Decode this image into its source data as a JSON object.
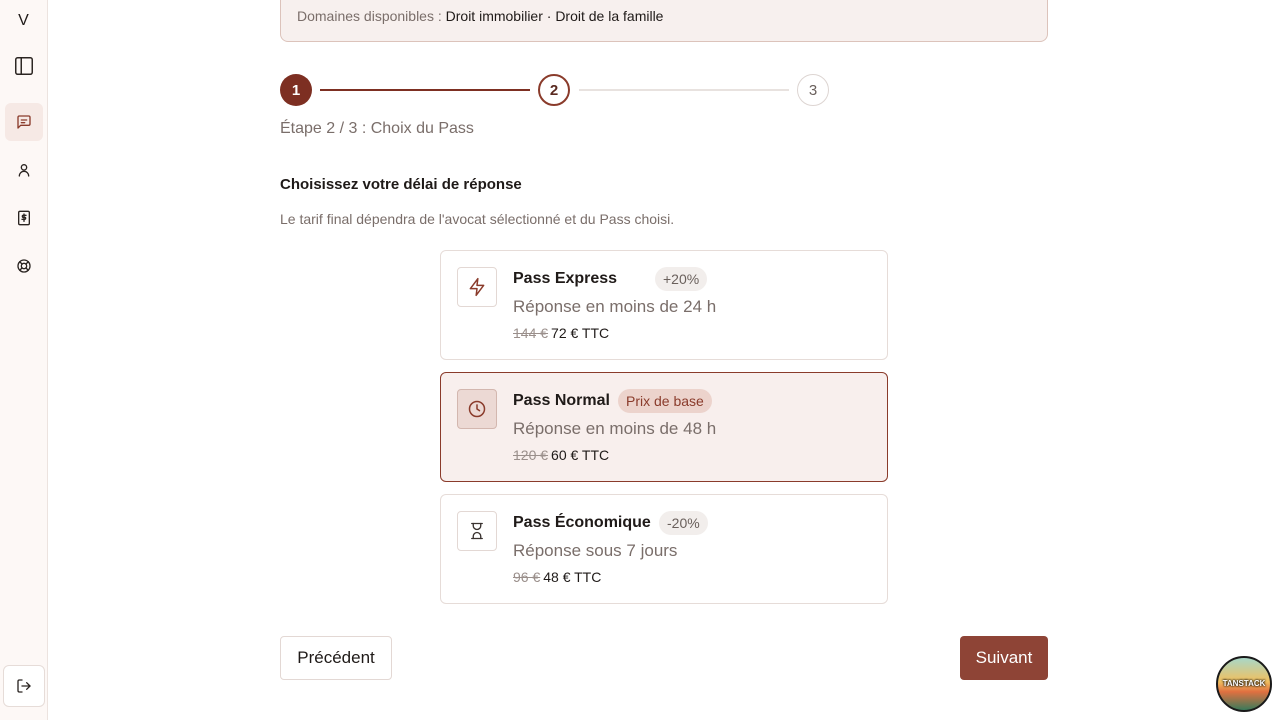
{
  "sidebar": {
    "logo": "V",
    "items": [
      {
        "name": "toggle-sidebar",
        "icon": "panel-left-icon"
      },
      {
        "name": "messages",
        "icon": "message-square-icon",
        "active": true
      },
      {
        "name": "profile",
        "icon": "user-icon"
      },
      {
        "name": "billing",
        "icon": "receipt-dollar-icon"
      },
      {
        "name": "support",
        "icon": "life-buoy-icon"
      }
    ],
    "logout_icon": "log-out-icon"
  },
  "domains": {
    "label": "Domaines disponibles : ",
    "value": "Droit immobilier · Droit de la famille"
  },
  "stepper": {
    "steps": [
      "1",
      "2",
      "3"
    ],
    "current": 2,
    "label": "Étape 2 / 3 : Choix du Pass"
  },
  "section": {
    "title": "Choisissez votre délai de réponse",
    "subtitle": "Le tarif final dépendra de l'avocat sélectionné et du Pass choisi."
  },
  "passes": [
    {
      "name": "Pass Express",
      "badge": "+20%",
      "description": "Réponse en moins de 24 h",
      "old_price": "144 €",
      "price": "72 € TTC",
      "icon": "zap-icon",
      "selected": false
    },
    {
      "name": "Pass Normal",
      "badge": "Prix de base",
      "description": "Réponse en moins de 48 h",
      "old_price": "120 €",
      "price": "60 € TTC",
      "icon": "clock-icon",
      "selected": true
    },
    {
      "name": "Pass Économique",
      "badge": "-20%",
      "description": "Réponse sous 7 jours",
      "old_price": "96 €",
      "price": "48 € TTC",
      "icon": "hourglass-icon",
      "selected": false
    }
  ],
  "actions": {
    "previous": "Précédent",
    "next": "Suivant"
  },
  "devtools": {
    "label": "TANSTACK"
  },
  "colors": {
    "accent": "#8a3b2b",
    "accent_dark": "#7d2f22",
    "button_primary": "#8e4436",
    "selected_bg": "#f8efed"
  }
}
